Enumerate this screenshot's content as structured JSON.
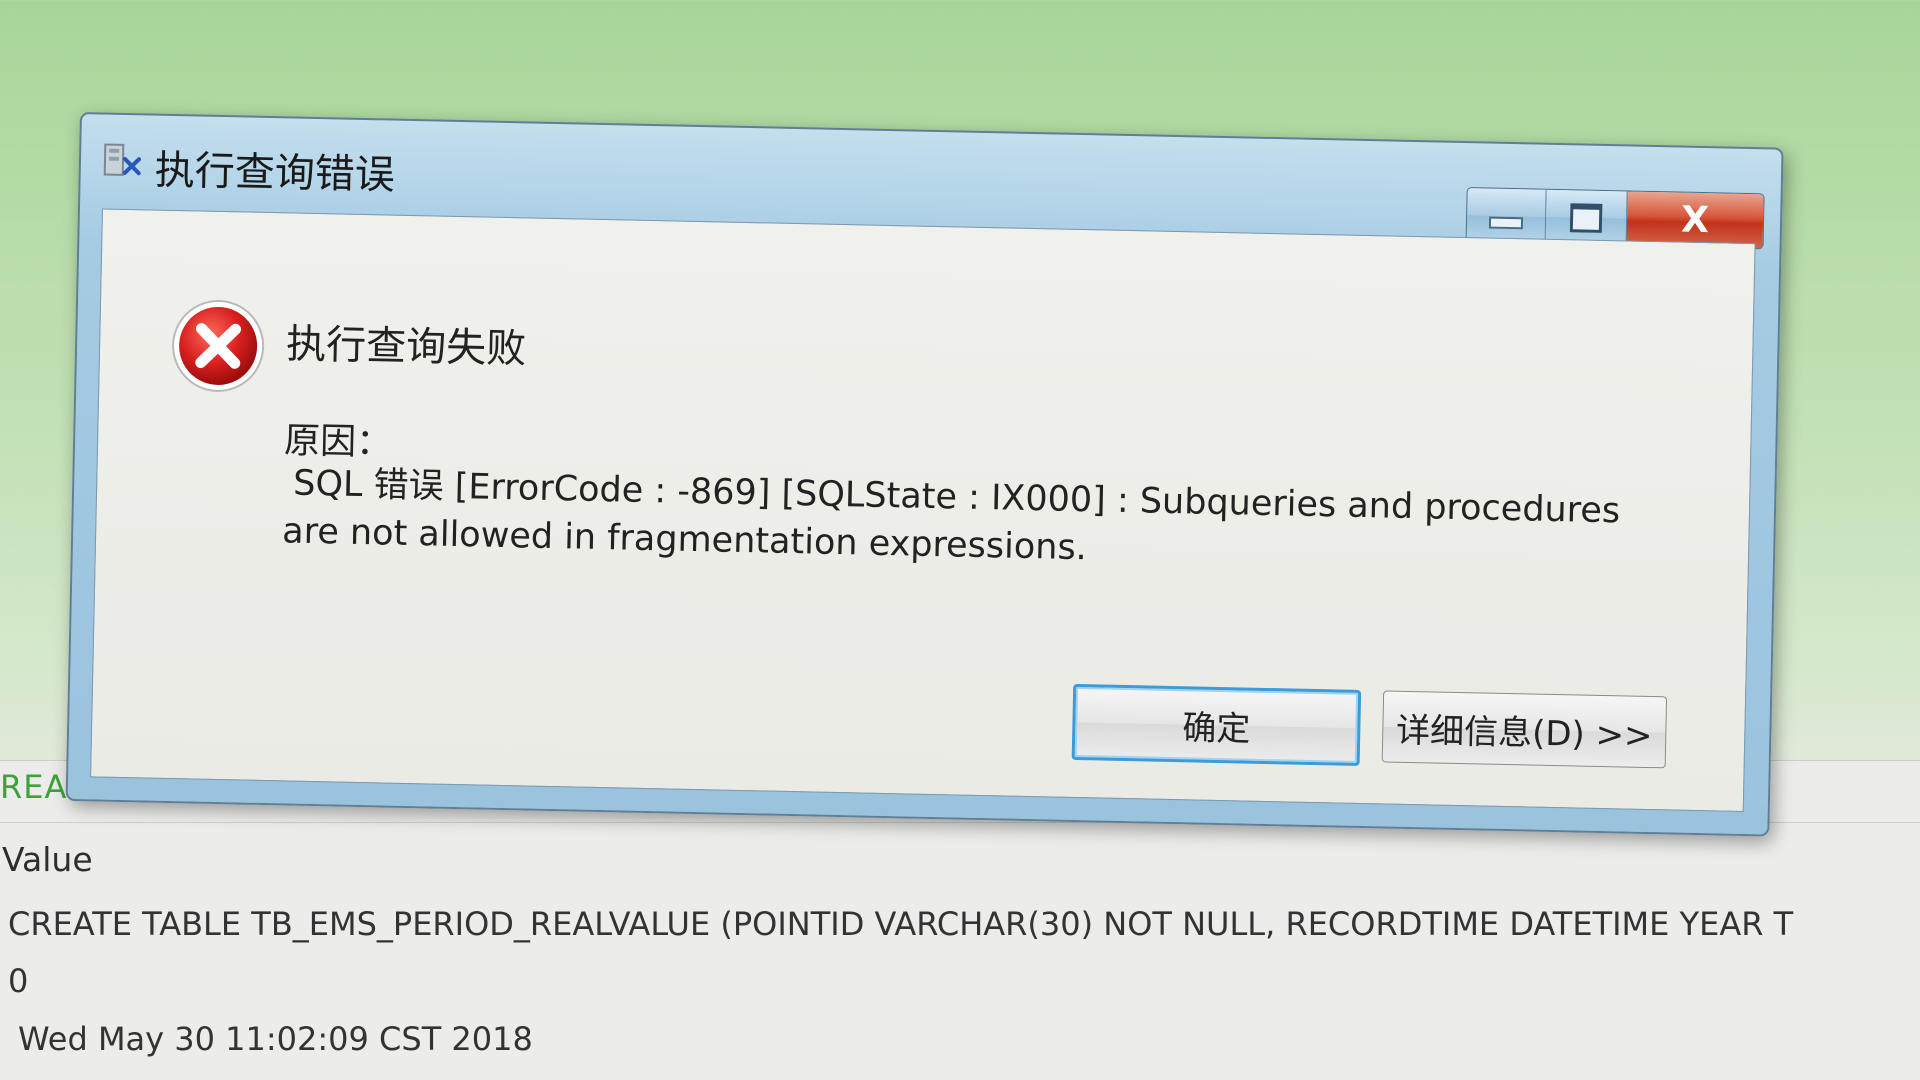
{
  "window": {
    "title": "执行查询错误",
    "close_label": "X"
  },
  "dialog": {
    "heading": "执行查询失败",
    "reason_label": "原因：",
    "message_line1": "SQL 错误 [ErrorCode : -869]  [SQLState : IX000] : Subqueries and procedures",
    "message_line2": "are not allowed in fragmentation expressions.",
    "ok_label": "确定",
    "details_label": "详细信息(D) >>"
  },
  "background": {
    "sql_fragment": "REALVALUE ( POINTID VA",
    "value_header": "Value",
    "rows": [
      "CREATE TABLE TB_EMS_PERIOD_REALVALUE (POINTID VARCHAR(30)  NOT NULL, RECORDTIME DATETIME YEAR T",
      "0",
      "Wed May 30 11:02:09 CST 2018"
    ]
  },
  "colors": {
    "title_bar": "#a6cbe3",
    "close_button": "#c1321a",
    "error_icon": "#d61f1f",
    "focus_border": "#3c9bd8",
    "sql_text": "#3aa43a"
  }
}
